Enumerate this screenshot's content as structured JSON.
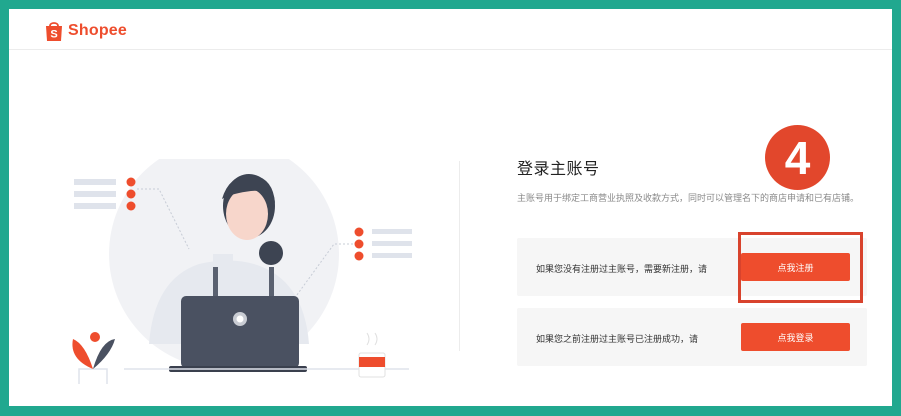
{
  "brand": {
    "name": "Shopee",
    "bag_glyph": "S",
    "color": "#ee4d2d"
  },
  "panel": {
    "title": "登录主账号",
    "description": "主账号用于绑定工商营业执照及收款方式，同时可以管理名下的商店申请和已有店铺。"
  },
  "options": [
    {
      "text": "如果您没有注册过主账号，需要新注册，请",
      "button": "点我注册"
    },
    {
      "text": "如果您之前注册过主账号已注册成功，请",
      "button": "点我登录"
    }
  ],
  "annotation": {
    "step": "4",
    "color": "#e2472c",
    "box_color": "#d8432d"
  },
  "frame_color": "#21a88f"
}
